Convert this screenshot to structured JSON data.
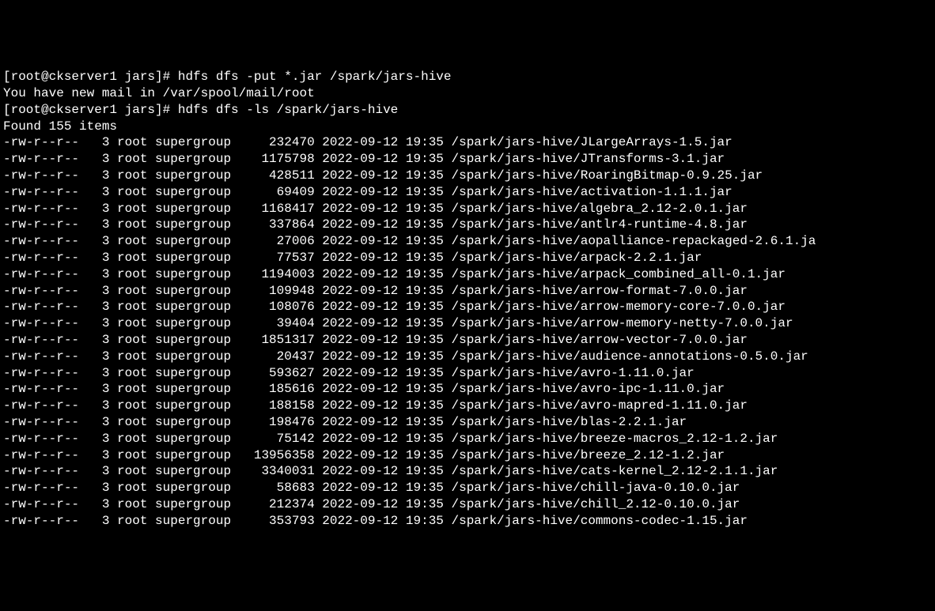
{
  "prompt1": "[root@ckserver1 jars]# ",
  "command1": "hdfs dfs -put *.jar /spark/jars-hive",
  "mail_message": "You have new mail in /var/spool/mail/root",
  "prompt2": "[root@ckserver1 jars]# ",
  "command2": "hdfs dfs -ls /spark/jars-hive",
  "found_message": "Found 155 items",
  "listing": [
    {
      "perms": "-rw-r--r--",
      "rep": "3",
      "owner": "root",
      "group": "supergroup",
      "size": "232470",
      "date": "2022-09-12",
      "time": "19:35",
      "path": "/spark/jars-hive/JLargeArrays-1.5.jar"
    },
    {
      "perms": "-rw-r--r--",
      "rep": "3",
      "owner": "root",
      "group": "supergroup",
      "size": "1175798",
      "date": "2022-09-12",
      "time": "19:35",
      "path": "/spark/jars-hive/JTransforms-3.1.jar"
    },
    {
      "perms": "-rw-r--r--",
      "rep": "3",
      "owner": "root",
      "group": "supergroup",
      "size": "428511",
      "date": "2022-09-12",
      "time": "19:35",
      "path": "/spark/jars-hive/RoaringBitmap-0.9.25.jar"
    },
    {
      "perms": "-rw-r--r--",
      "rep": "3",
      "owner": "root",
      "group": "supergroup",
      "size": "69409",
      "date": "2022-09-12",
      "time": "19:35",
      "path": "/spark/jars-hive/activation-1.1.1.jar"
    },
    {
      "perms": "-rw-r--r--",
      "rep": "3",
      "owner": "root",
      "group": "supergroup",
      "size": "1168417",
      "date": "2022-09-12",
      "time": "19:35",
      "path": "/spark/jars-hive/algebra_2.12-2.0.1.jar"
    },
    {
      "perms": "-rw-r--r--",
      "rep": "3",
      "owner": "root",
      "group": "supergroup",
      "size": "337864",
      "date": "2022-09-12",
      "time": "19:35",
      "path": "/spark/jars-hive/antlr4-runtime-4.8.jar"
    },
    {
      "perms": "-rw-r--r--",
      "rep": "3",
      "owner": "root",
      "group": "supergroup",
      "size": "27006",
      "date": "2022-09-12",
      "time": "19:35",
      "path": "/spark/jars-hive/aopalliance-repackaged-2.6.1.ja"
    },
    {
      "perms": "-rw-r--r--",
      "rep": "3",
      "owner": "root",
      "group": "supergroup",
      "size": "77537",
      "date": "2022-09-12",
      "time": "19:35",
      "path": "/spark/jars-hive/arpack-2.2.1.jar"
    },
    {
      "perms": "-rw-r--r--",
      "rep": "3",
      "owner": "root",
      "group": "supergroup",
      "size": "1194003",
      "date": "2022-09-12",
      "time": "19:35",
      "path": "/spark/jars-hive/arpack_combined_all-0.1.jar"
    },
    {
      "perms": "-rw-r--r--",
      "rep": "3",
      "owner": "root",
      "group": "supergroup",
      "size": "109948",
      "date": "2022-09-12",
      "time": "19:35",
      "path": "/spark/jars-hive/arrow-format-7.0.0.jar"
    },
    {
      "perms": "-rw-r--r--",
      "rep": "3",
      "owner": "root",
      "group": "supergroup",
      "size": "108076",
      "date": "2022-09-12",
      "time": "19:35",
      "path": "/spark/jars-hive/arrow-memory-core-7.0.0.jar"
    },
    {
      "perms": "-rw-r--r--",
      "rep": "3",
      "owner": "root",
      "group": "supergroup",
      "size": "39404",
      "date": "2022-09-12",
      "time": "19:35",
      "path": "/spark/jars-hive/arrow-memory-netty-7.0.0.jar"
    },
    {
      "perms": "-rw-r--r--",
      "rep": "3",
      "owner": "root",
      "group": "supergroup",
      "size": "1851317",
      "date": "2022-09-12",
      "time": "19:35",
      "path": "/spark/jars-hive/arrow-vector-7.0.0.jar"
    },
    {
      "perms": "-rw-r--r--",
      "rep": "3",
      "owner": "root",
      "group": "supergroup",
      "size": "20437",
      "date": "2022-09-12",
      "time": "19:35",
      "path": "/spark/jars-hive/audience-annotations-0.5.0.jar"
    },
    {
      "perms": "-rw-r--r--",
      "rep": "3",
      "owner": "root",
      "group": "supergroup",
      "size": "593627",
      "date": "2022-09-12",
      "time": "19:35",
      "path": "/spark/jars-hive/avro-1.11.0.jar"
    },
    {
      "perms": "-rw-r--r--",
      "rep": "3",
      "owner": "root",
      "group": "supergroup",
      "size": "185616",
      "date": "2022-09-12",
      "time": "19:35",
      "path": "/spark/jars-hive/avro-ipc-1.11.0.jar"
    },
    {
      "perms": "-rw-r--r--",
      "rep": "3",
      "owner": "root",
      "group": "supergroup",
      "size": "188158",
      "date": "2022-09-12",
      "time": "19:35",
      "path": "/spark/jars-hive/avro-mapred-1.11.0.jar"
    },
    {
      "perms": "-rw-r--r--",
      "rep": "3",
      "owner": "root",
      "group": "supergroup",
      "size": "198476",
      "date": "2022-09-12",
      "time": "19:35",
      "path": "/spark/jars-hive/blas-2.2.1.jar"
    },
    {
      "perms": "-rw-r--r--",
      "rep": "3",
      "owner": "root",
      "group": "supergroup",
      "size": "75142",
      "date": "2022-09-12",
      "time": "19:35",
      "path": "/spark/jars-hive/breeze-macros_2.12-1.2.jar"
    },
    {
      "perms": "-rw-r--r--",
      "rep": "3",
      "owner": "root",
      "group": "supergroup",
      "size": "13956358",
      "date": "2022-09-12",
      "time": "19:35",
      "path": "/spark/jars-hive/breeze_2.12-1.2.jar"
    },
    {
      "perms": "-rw-r--r--",
      "rep": "3",
      "owner": "root",
      "group": "supergroup",
      "size": "3340031",
      "date": "2022-09-12",
      "time": "19:35",
      "path": "/spark/jars-hive/cats-kernel_2.12-2.1.1.jar"
    },
    {
      "perms": "-rw-r--r--",
      "rep": "3",
      "owner": "root",
      "group": "supergroup",
      "size": "58683",
      "date": "2022-09-12",
      "time": "19:35",
      "path": "/spark/jars-hive/chill-java-0.10.0.jar"
    },
    {
      "perms": "-rw-r--r--",
      "rep": "3",
      "owner": "root",
      "group": "supergroup",
      "size": "212374",
      "date": "2022-09-12",
      "time": "19:35",
      "path": "/spark/jars-hive/chill_2.12-0.10.0.jar"
    },
    {
      "perms": "-rw-r--r--",
      "rep": "3",
      "owner": "root",
      "group": "supergroup",
      "size": "353793",
      "date": "2022-09-12",
      "time": "19:35",
      "path": "/spark/jars-hive/commons-codec-1.15.jar"
    }
  ]
}
